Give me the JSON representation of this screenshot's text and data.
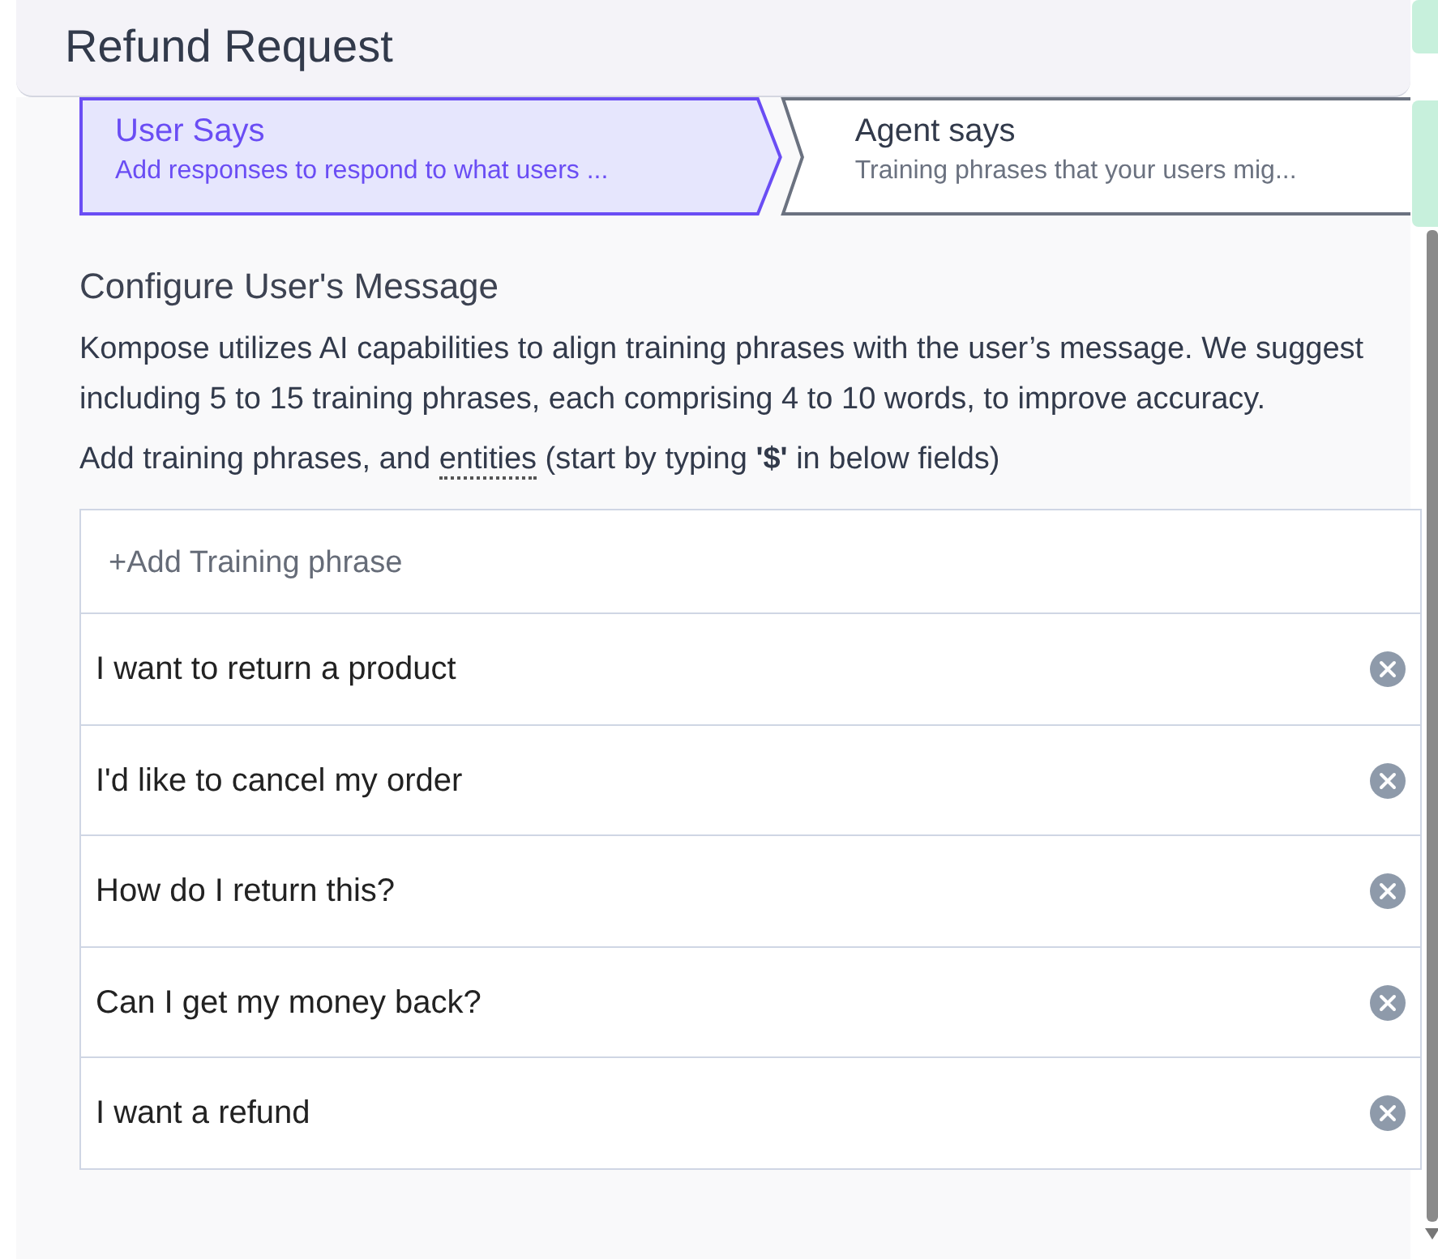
{
  "header": {
    "title": "Refund Request"
  },
  "steps": [
    {
      "title": "User Says",
      "subtitle": "Add responses to respond to what users ...",
      "selected": true
    },
    {
      "title": "Agent says",
      "subtitle": "Training phrases that your users mig...",
      "selected": false
    }
  ],
  "section": {
    "heading": "Configure User's Message",
    "description": "Kompose utilizes AI capabilities to align training phrases with the user’s message. We suggest including 5 to 15 training phrases, each comprising 4 to 10 words, to improve accuracy.",
    "hint_before": "Add training phrases, and ",
    "hint_term": "entities",
    "hint_after": " (start by typing **'$'** in below fields)"
  },
  "add_field": {
    "placeholder": "+Add Training phrase"
  },
  "phrases": [
    {
      "value": "I want to return a product"
    },
    {
      "value": "I'd like to cancel my order"
    },
    {
      "value": "How do I return this?"
    },
    {
      "value": "Can I get my money back?"
    },
    {
      "value": "I want a refund"
    }
  ]
}
